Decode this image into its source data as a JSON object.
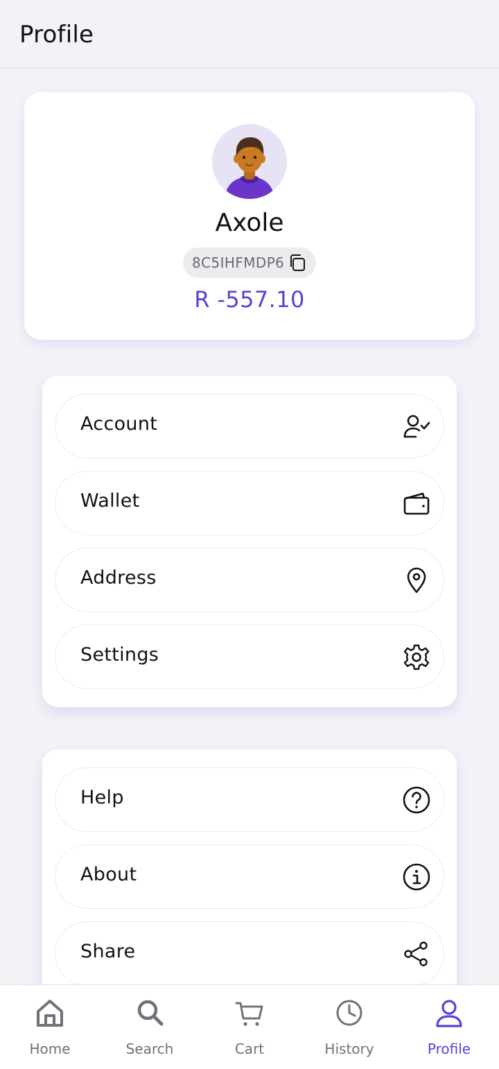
{
  "header": {
    "title": "Profile"
  },
  "profile": {
    "name": "Axole",
    "code": "8C5IHFMDP6",
    "balance": "R -557.10",
    "avatar_icon": "person-avatar-icon"
  },
  "menu_primary": [
    {
      "label": "Account",
      "icon": "user-check-icon"
    },
    {
      "label": "Wallet",
      "icon": "wallet-icon"
    },
    {
      "label": "Address",
      "icon": "map-pin-icon"
    },
    {
      "label": "Settings",
      "icon": "gear-icon"
    }
  ],
  "menu_secondary": [
    {
      "label": "Help",
      "icon": "help-circle-icon"
    },
    {
      "label": "About",
      "icon": "info-circle-icon"
    },
    {
      "label": "Share",
      "icon": "share-icon"
    }
  ],
  "bottom_nav": {
    "active": "Profile",
    "items": [
      {
        "label": "Home",
        "icon": "home-icon"
      },
      {
        "label": "Search",
        "icon": "search-icon"
      },
      {
        "label": "Cart",
        "icon": "cart-icon"
      },
      {
        "label": "History",
        "icon": "clock-icon"
      },
      {
        "label": "Profile",
        "icon": "user-icon"
      }
    ]
  },
  "colors": {
    "accent": "#5b3fd6",
    "background": "#f2f3f7",
    "card": "#ffffff",
    "muted_text": "#707078"
  }
}
